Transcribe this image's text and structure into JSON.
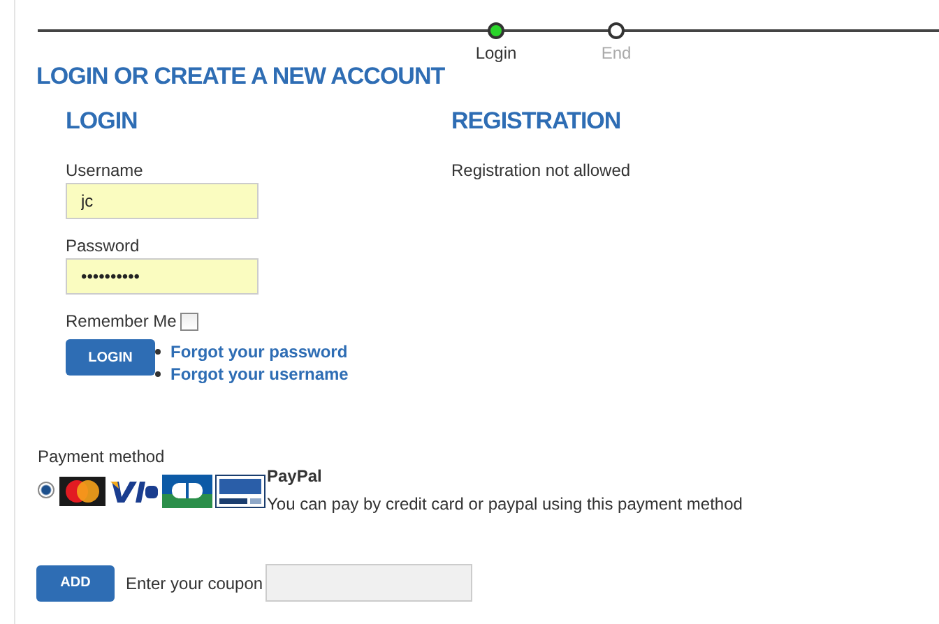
{
  "progress": {
    "steps": [
      {
        "label": "Login",
        "selected": true
      },
      {
        "label": "End",
        "selected": false
      }
    ]
  },
  "title": "LOGIN OR CREATE A NEW ACCOUNT",
  "login": {
    "heading": "LOGIN",
    "fields": [
      {
        "label": "Username",
        "value": "jc"
      },
      {
        "label": "Password",
        "value": "••••••••••"
      }
    ],
    "remember": {
      "label": "Remember Me",
      "checked": false
    },
    "button": "LOGIN",
    "links": [
      "Forgot your password",
      "Forgot your username"
    ]
  },
  "registration": {
    "heading": "REGISTRATION",
    "message": "Registration not allowed"
  },
  "payment": {
    "label": "Payment method",
    "methods": [
      {
        "name": "PayPal",
        "description": "You can pay by credit card or paypal using this payment method",
        "selected": true
      }
    ]
  },
  "coupon": {
    "button": "ADD",
    "label": "Enter your coupon"
  }
}
